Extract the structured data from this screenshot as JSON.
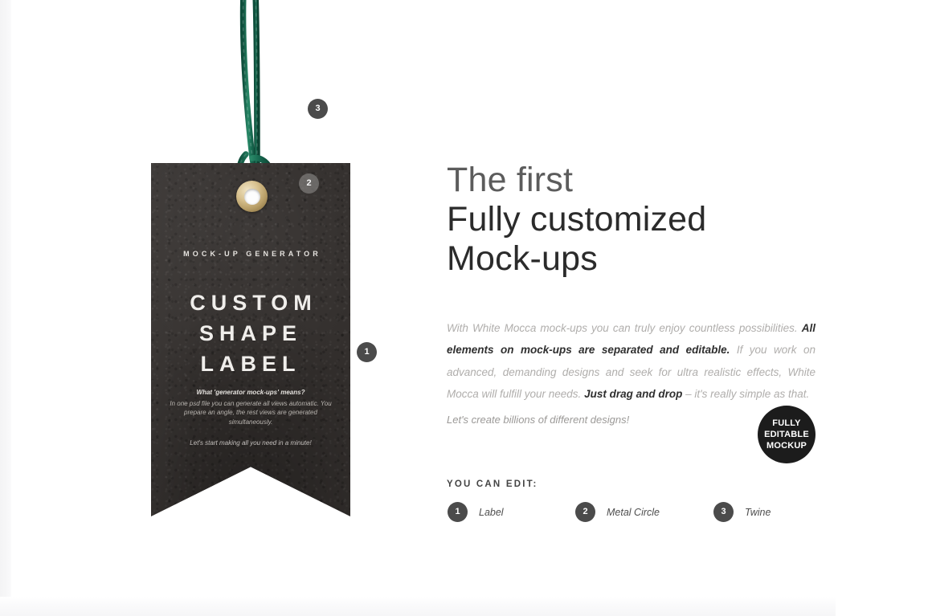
{
  "mockup": {
    "tag": {
      "kicker": "MOCK-UP GENERATOR",
      "headline_line_1": "CUSTOM",
      "headline_line_2": "SHAPE",
      "headline_line_3": "LABEL",
      "sub_title": "What 'generator mock-ups' means?",
      "sub_body": "In one psd file you can generate all views automatic. You prepare an angle, the rest views are generated simultaneously.",
      "sub_tail": "Let's start making all you need in a minute!"
    },
    "markers": [
      {
        "number": "1",
        "target": "label"
      },
      {
        "number": "2",
        "target": "metal-circle"
      },
      {
        "number": "3",
        "target": "twine"
      }
    ],
    "colors": {
      "tag": "#332f2d",
      "twine": "#1b6b52",
      "grommet": "#c3a871",
      "marker": "#4b4b4b"
    }
  },
  "copy": {
    "headline": {
      "line_1": "The first",
      "line_2": "Fully customized",
      "line_3": "Mock-ups"
    },
    "body": {
      "part_1": "With White Mocca mock-ups you can truly enjoy countless possibilities. ",
      "bold_1": "All elements on mock-ups are separated and editable.",
      "part_2": " If you work on advanced, demanding designs and seek for ultra realistic effects, White Mocca will fulfill your needs. ",
      "bold_2": "Just drag and drop",
      "part_3": " – it's really simple as that."
    },
    "tagline": "Let's create billions of different designs!",
    "badge": {
      "line_1": "FULLY",
      "line_2": "EDITABLE",
      "line_3": "MOCKUP",
      "color": "#1c1c1c"
    },
    "legend": {
      "title": "YOU CAN EDIT:",
      "items": [
        {
          "number": "1",
          "label": "Label"
        },
        {
          "number": "2",
          "label": "Metal Circle"
        },
        {
          "number": "3",
          "label": "Twine"
        }
      ]
    }
  }
}
